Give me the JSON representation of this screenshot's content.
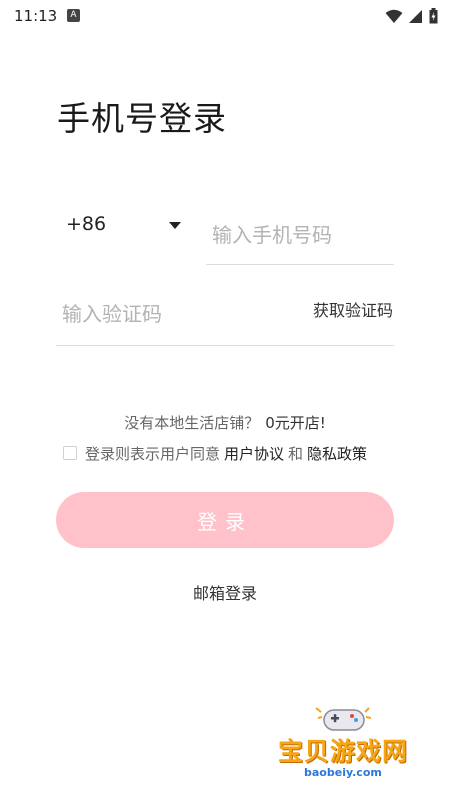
{
  "status_bar": {
    "time": "11:13",
    "notification_icon": "A"
  },
  "title": "手机号登录",
  "phone": {
    "country_code": "+86",
    "placeholder": "输入手机号码",
    "value": ""
  },
  "code": {
    "placeholder": "输入验证码",
    "value": "",
    "get_code_label": "获取验证码"
  },
  "promo": {
    "text": "没有本地生活店铺？",
    "link": "0元开店!"
  },
  "agreement": {
    "checked": false,
    "prefix": "登录则表示用户同意",
    "user_agreement": "用户协议",
    "conjunction": "和",
    "privacy_policy": "隐私政策"
  },
  "login_button": {
    "label": "登录",
    "color": "#ffc2cb"
  },
  "email_login_label": "邮箱登录",
  "watermark": {
    "text": "宝贝游戏网",
    "url": "baobeiy.com"
  }
}
